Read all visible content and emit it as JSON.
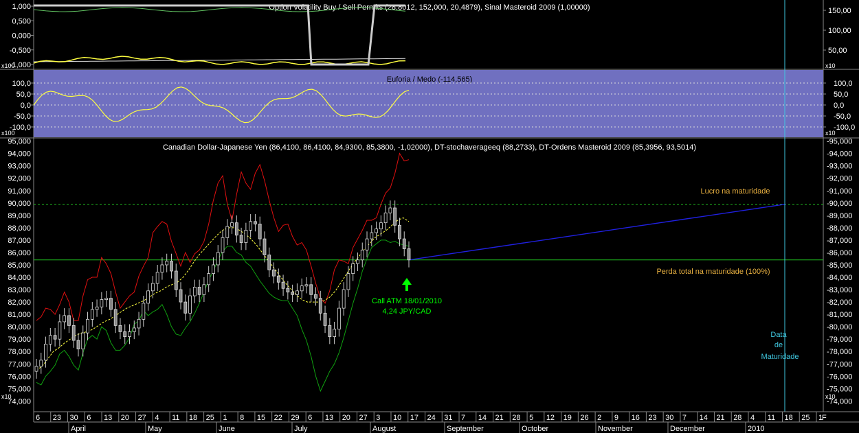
{
  "panels": {
    "top": {
      "title": "Option Volatility Buy / Sell Permits (28,8012, 152,000, 20,4879), Sinal Masteroid 2009 (1,00000)",
      "left_ticks": [
        "1,000",
        "0,500",
        "0,000",
        "-0,500",
        "-1,000"
      ],
      "right_ticks": [
        "150,00",
        "100,00",
        "50,00"
      ],
      "scale_tag": "x100",
      "right_tag": "x10"
    },
    "middle": {
      "title": "Euforia / Medo (-114,565)",
      "left_ticks": [
        "100,0",
        "50,0",
        "0,0",
        "-50,0",
        "-100,0"
      ],
      "right_ticks": [
        "100,0",
        "50,0",
        "0,0",
        "-50,0",
        "-100,0"
      ],
      "scale_tag": "x100",
      "right_tag": "x10",
      "band_color": "#7070c0"
    },
    "main": {
      "title": "Canadian Dollar-Japanese Yen (86,4100, 86,4100, 84,9300, 85,3800, -1,02000), DT-stochaverageeq (88,2733), DT-Ordens Masteroid 2009 (85,3956, 93,5014)",
      "scale_tag": "x10",
      "right_tag": "x10"
    }
  },
  "annotations": {
    "profit_label": "Lucro na maturidade",
    "loss_label": "Perda total na maturidade (100%)",
    "call_line1": "Call ATM 18/01/2010",
    "call_line2": "4,24 JPY/CAD",
    "maturity_line1": "Data",
    "maturity_line2": "de",
    "maturity_line3": "Maturidade"
  },
  "colors": {
    "upper_band": "#e01010",
    "lower_band": "#10a010",
    "stoch_avg": "#ffff40",
    "projection": "#2020e0",
    "levels": "#20c020",
    "maturity": "#40c8e0",
    "label": "#e8b040",
    "call_arrow": "#00ff00"
  },
  "x_axis": {
    "day_ticks": [
      "6",
      "23",
      "30",
      "6",
      "13",
      "20",
      "27",
      "4",
      "11",
      "18",
      "25",
      "1",
      "8",
      "15",
      "22",
      "29",
      "6",
      "13",
      "20",
      "27",
      "3",
      "10",
      "17",
      "24",
      "31",
      "7",
      "14",
      "21",
      "28",
      "5",
      "12",
      "19",
      "26",
      "2",
      "9",
      "16",
      "23",
      "30",
      "7",
      "14",
      "21",
      "28",
      "4",
      "11",
      "18",
      "25",
      "1"
    ],
    "months": [
      "April",
      "May",
      "June",
      "July",
      "August",
      "September",
      "October",
      "November",
      "December",
      "2010"
    ],
    "last_tick": "F"
  },
  "chart_data": {
    "type": "candlestick",
    "title": "Canadian Dollar-Japanese Yen (86,4100, 86,4100, 84,9300, 85,3800, -1,02000), DT-stochaverageeq (88,2733), DT-Ordens Masteroid 2009 (85,3956, 93,5014)",
    "y_ticks": [
      "95,000",
      "94,000",
      "93,000",
      "92,000",
      "91,000",
      "90,000",
      "89,000",
      "88,000",
      "87,000",
      "86,000",
      "85,000",
      "84,000",
      "83,000",
      "82,000",
      "81,000",
      "80,000",
      "79,000",
      "78,000",
      "77,000",
      "76,000",
      "75,000",
      "74,000"
    ],
    "ylim": [
      73.3,
      95.2
    ],
    "close_series": [
      76.8,
      77.3,
      78.6,
      79.3,
      79.0,
      80.4,
      80.9,
      80.1,
      78.9,
      78.2,
      79.5,
      80.6,
      81.4,
      81.6,
      82.2,
      82.3,
      81.4,
      80.1,
      79.6,
      79.2,
      79.6,
      79.9,
      80.6,
      81.9,
      82.9,
      83.5,
      84.4,
      85.0,
      85.3,
      84.5,
      83.0,
      82.0,
      81.1,
      82.5,
      83.2,
      82.6,
      83.4,
      84.3,
      85.0,
      86.0,
      87.2,
      88.1,
      88.4,
      87.4,
      86.8,
      87.8,
      88.5,
      88.3,
      87.1,
      85.8,
      84.6,
      84.1,
      83.6,
      83.1,
      82.8,
      82.6,
      82.9,
      83.3,
      83.4,
      82.6,
      82.3,
      81.1,
      80.1,
      79.2,
      79.8,
      81.5,
      83.0,
      84.3,
      85.1,
      85.4,
      86.2,
      87.1,
      87.6,
      87.9,
      88.4,
      89.2,
      89.6,
      88.2,
      87.1,
      86.3,
      85.4
    ],
    "upper_band": [
      80.5,
      80.8,
      81.5,
      81.4,
      81.0,
      81.8,
      82.8,
      82.0,
      80.5,
      80.5,
      82.5,
      83.8,
      84.0,
      84.0,
      85.6,
      85.1,
      84.3,
      82.8,
      81.5,
      82.0,
      82.5,
      82.8,
      84.1,
      84.9,
      85.6,
      87.6,
      88.1,
      88.5,
      88.3,
      86.9,
      85.9,
      84.9,
      86.0,
      85.2,
      85.9,
      86.2,
      86.9,
      88.3,
      90.2,
      91.6,
      92.2,
      89.9,
      88.6,
      90.7,
      92.5,
      91.6,
      91.1,
      92.4,
      93.1,
      91.8,
      90.2,
      88.8,
      87.7,
      88.2,
      88.3,
      87.3,
      86.6,
      86.8,
      86.2,
      84.9,
      83.5,
      82.3,
      81.9,
      82.9,
      84.6,
      85.4,
      85.3,
      85.1,
      86.4,
      87.1,
      87.8,
      88.6,
      88.6,
      88.8,
      89.9,
      90.8,
      91.2,
      92.4,
      94.0,
      93.4,
      93.5
    ],
    "lower_band": [
      75.5,
      75.3,
      76.0,
      76.4,
      76.9,
      77.8,
      78.1,
      77.6,
      76.9,
      76.5,
      77.9,
      79.0,
      79.3,
      79.0,
      80.0,
      79.7,
      78.7,
      78.1,
      78.1,
      78.5,
      79.1,
      80.2,
      80.5,
      81.3,
      80.9,
      81.2,
      81.4,
      81.8,
      81.0,
      80.0,
      79.4,
      79.3,
      79.9,
      80.4,
      81.1,
      81.9,
      82.8,
      83.8,
      84.5,
      85.4,
      86.1,
      86.5,
      86.5,
      86.0,
      85.8,
      85.2,
      84.9,
      84.3,
      83.7,
      83.2,
      82.7,
      82.4,
      82.2,
      82.1,
      82.1,
      81.5,
      80.9,
      79.8,
      78.9,
      77.6,
      76.0,
      74.8,
      75.6,
      76.4,
      77.0,
      77.9,
      79.1,
      80.5,
      81.9,
      83.1,
      84.5,
      85.5,
      86.4,
      86.7,
      87.0,
      87.0,
      86.8,
      86.9,
      86.7,
      86.6,
      86.5
    ],
    "stoch_average": [
      76.5,
      76.8,
      77.4,
      78.0,
      78.3,
      78.7,
      79.0,
      79.3,
      79.5,
      79.6,
      79.8,
      80.1,
      80.4,
      80.6,
      80.9,
      81.2,
      81.5,
      81.7,
      81.9,
      82.1,
      82.4,
      82.7,
      82.9,
      83.2,
      83.4,
      83.6,
      84.0,
      84.6,
      85.3,
      85.9,
      86.4,
      86.9,
      87.4,
      87.8,
      88.0,
      88.0,
      87.8,
      87.5,
      87.1,
      86.6,
      86.0,
      85.4,
      84.8,
      84.2,
      83.6,
      83.1,
      82.6,
      82.2,
      82.0,
      82.0,
      82.0,
      82.1,
      82.4,
      82.9,
      83.6,
      84.3,
      85.0,
      85.6,
      86.2,
      86.7,
      87.2,
      87.5,
      87.8,
      88.2,
      88.6,
      88.8,
      88.5
    ],
    "profit_level": 89.9,
    "loss_level": 85.4,
    "projection": {
      "from": 85.4,
      "to": 89.9
    }
  }
}
